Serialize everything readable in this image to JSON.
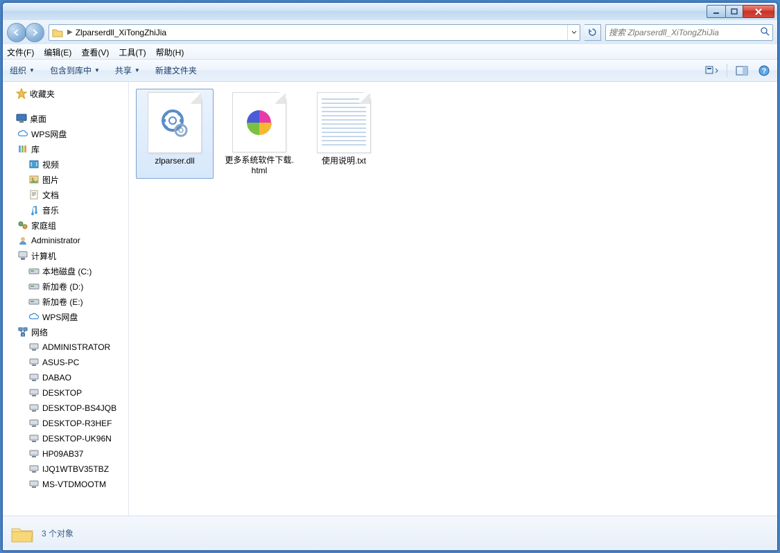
{
  "address": {
    "folder_name": "Zlparserdll_XiTongZhiJia"
  },
  "search": {
    "placeholder": "搜索 Zlparserdll_XiTongZhiJia"
  },
  "menu": {
    "file": "文件(F)",
    "edit": "编辑(E)",
    "view": "查看(V)",
    "tools": "工具(T)",
    "help": "帮助(H)"
  },
  "toolbar": {
    "organize": "组织",
    "include": "包含到库中",
    "share": "共享",
    "new_folder": "新建文件夹"
  },
  "sidebar": {
    "favorites": "收藏夹",
    "desktop": "桌面",
    "wps": "WPS网盘",
    "libraries": "库",
    "videos": "视频",
    "pictures": "图片",
    "documents": "文档",
    "music": "音乐",
    "homegroup": "家庭组",
    "admin": "Administrator",
    "computer": "计算机",
    "disk_c": "本地磁盘 (C:)",
    "disk_d": "新加卷 (D:)",
    "disk_e": "新加卷 (E:)",
    "wps2": "WPS网盘",
    "network": "网络",
    "net_items": [
      "ADMINISTRATOR",
      "ASUS-PC",
      "DABAO",
      "DESKTOP",
      "DESKTOP-BS4JQB",
      "DESKTOP-R3HEF",
      "DESKTOP-UK96N",
      "HP09AB37",
      "IJQ1WTBV35TBZ",
      "MS-VTDMOOTM"
    ]
  },
  "files": [
    {
      "name": "zlparser.dll",
      "type": "dll",
      "selected": true
    },
    {
      "name": "更多系统软件下载.html",
      "type": "html",
      "selected": false
    },
    {
      "name": "使用说明.txt",
      "type": "txt",
      "selected": false
    }
  ],
  "status": {
    "text": "3 个对象"
  }
}
